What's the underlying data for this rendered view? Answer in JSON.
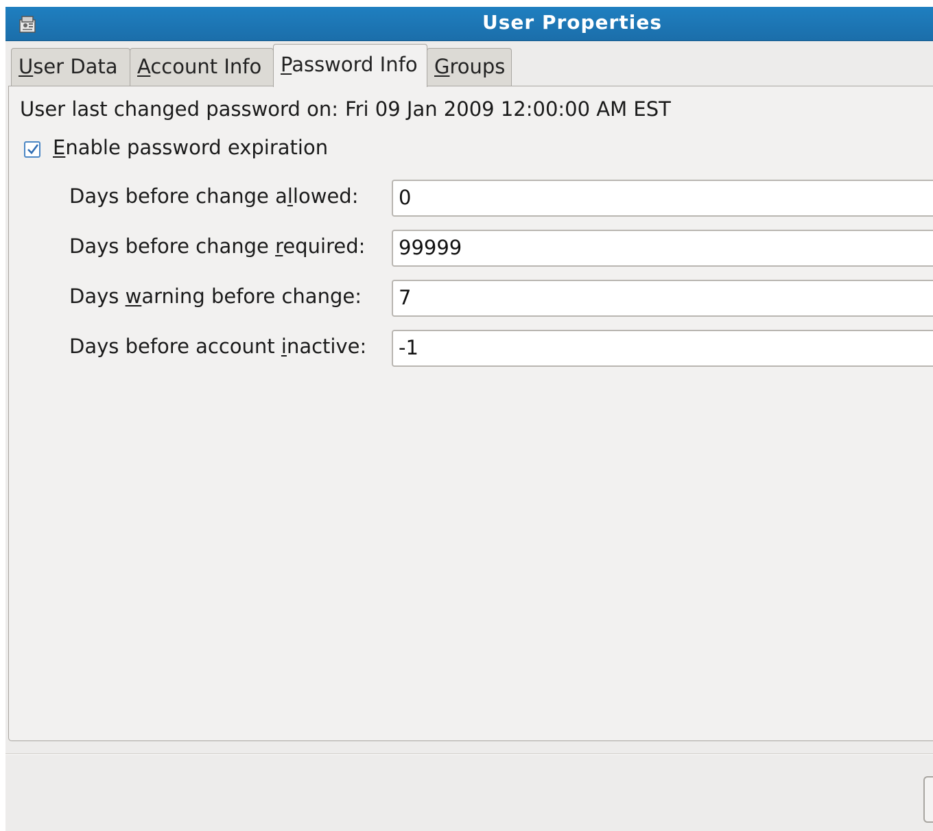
{
  "window": {
    "title": "User Properties",
    "titlebar_color": "#1f7fc0"
  },
  "tabs": [
    {
      "pre": "",
      "mnemonic": "U",
      "post": "ser Data",
      "active": false
    },
    {
      "pre": "",
      "mnemonic": "A",
      "post": "ccount Info",
      "active": false
    },
    {
      "pre": "",
      "mnemonic": "P",
      "post": "assword Info",
      "active": true
    },
    {
      "pre": "",
      "mnemonic": "G",
      "post": "roups",
      "active": false
    }
  ],
  "password_info": {
    "last_changed_label": "User last changed password on:",
    "last_changed_value": "Fri 09 Jan 2009 12:00:00 AM EST",
    "expiration_checkbox": {
      "mnemonic": "E",
      "post": "nable password expiration",
      "checked": true
    },
    "fields": [
      {
        "pre": "Days before change a",
        "mnemonic": "l",
        "post": "lowed:",
        "value": "0"
      },
      {
        "pre": "Days before change ",
        "mnemonic": "r",
        "post": "equired:",
        "value": "99999"
      },
      {
        "pre": "Days ",
        "mnemonic": "w",
        "post": "arning before change:",
        "value": "7"
      },
      {
        "pre": "Days before account ",
        "mnemonic": "i",
        "post": "nactive:",
        "value": "-1"
      }
    ]
  },
  "icons": {
    "title": "user-properties-icon",
    "check": "checkmark-icon"
  }
}
